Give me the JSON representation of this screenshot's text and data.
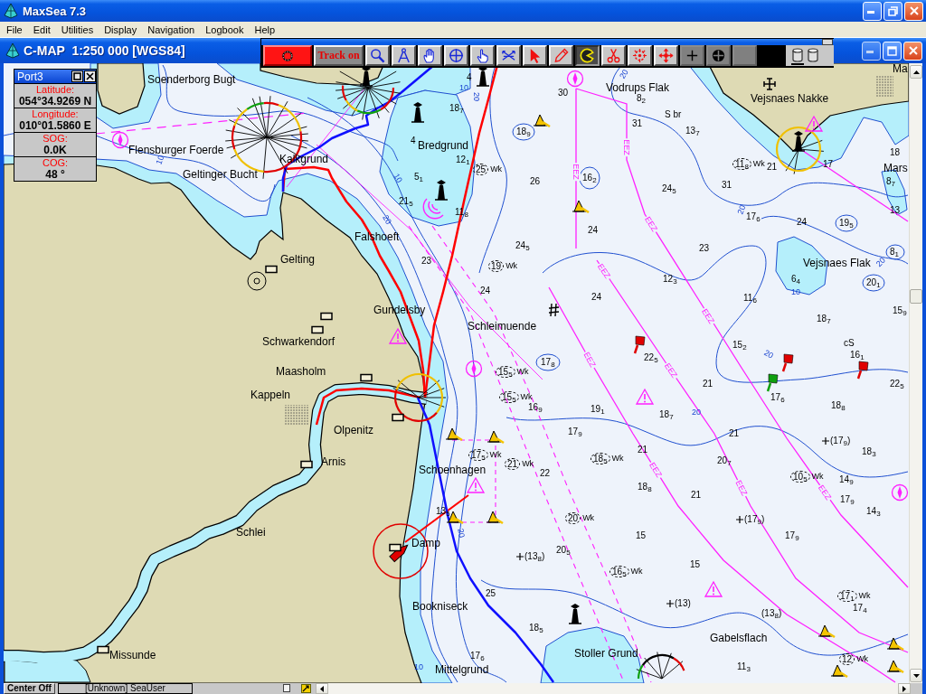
{
  "app_window": {
    "title": "MaxSea 7.3"
  },
  "menu": [
    "File",
    "Edit",
    "Utilities",
    "Display",
    "Navigation",
    "Logbook",
    "Help"
  ],
  "chart_window": {
    "title": "C-MAP  1:250 000 [WGS84]"
  },
  "toolbar": {
    "buttons": [
      {
        "kind": "record",
        "selected": false,
        "disabled": false
      },
      {
        "kind": "text",
        "label": "Track on",
        "selected": false,
        "disabled": false
      },
      {
        "kind": "magnifier",
        "selected": false,
        "disabled": false
      },
      {
        "kind": "dividers",
        "selected": false,
        "disabled": false
      },
      {
        "kind": "hand",
        "selected": false,
        "disabled": false
      },
      {
        "kind": "crosshair",
        "selected": false,
        "disabled": false
      },
      {
        "kind": "pointing-hand",
        "selected": false,
        "disabled": false
      },
      {
        "kind": "crossed-lines",
        "selected": false,
        "disabled": false
      },
      {
        "kind": "arrow",
        "selected": false,
        "disabled": false
      },
      {
        "kind": "pencil",
        "selected": false,
        "disabled": false
      },
      {
        "kind": "pie",
        "selected": true,
        "disabled": false
      },
      {
        "kind": "scissors",
        "selected": false,
        "disabled": false
      },
      {
        "kind": "target",
        "selected": false,
        "disabled": false
      },
      {
        "kind": "move",
        "selected": false,
        "disabled": false
      },
      {
        "kind": "plus",
        "selected": false,
        "disabled": true
      },
      {
        "kind": "circle-plus",
        "selected": false,
        "disabled": true
      },
      {
        "kind": "blank",
        "selected": false,
        "disabled": true
      }
    ],
    "layers": [
      {
        "selected": true
      },
      {
        "selected": false
      }
    ]
  },
  "position_window": {
    "title": "Port3",
    "fields": [
      {
        "label": "Latitude:",
        "value": "054°34.9269 N"
      },
      {
        "label": "Longitude:",
        "value": "010°01.5860 E"
      },
      {
        "label": "SOG:",
        "value": "0.0K"
      },
      {
        "label": "COG:",
        "value": "48 °"
      }
    ]
  },
  "chart": {
    "place_names": [
      "Ma",
      "Soenderborg Bugt",
      "Vodrups Flak",
      "Vejsnaes Nakke",
      "Flensburger Foerde",
      "Bredgrund",
      "Kalkgrund",
      "Geltinger Bucht",
      "Mars",
      "Falshoeft",
      "Gelting",
      "Vejsnaes Flak",
      "Gundelsby",
      "Schleimuende",
      "Schwarkendorf",
      "Maasholm",
      "Kappeln",
      "Olpenitz",
      "Arnis",
      "Schoenhagen",
      "Schlei",
      "Damp",
      "Bookniseck",
      "Gabelsflach",
      "Missunde",
      "Stoller Grund",
      "Mittelgrund"
    ],
    "soundings": [
      "4",
      "30",
      "8$_{2}$",
      "18$_{7}$",
      "31",
      "18$_{9}$",
      "13$_{7}$",
      "4",
      "18",
      "12$_{1}$",
      "21",
      "17",
      "5$_{1}$",
      "26",
      "16$_{2}$",
      "24$_{5}$",
      "31",
      "8$_{7}$",
      "21$_{5}$",
      "11$_{8}$",
      "17$_{6}$",
      "13",
      "24",
      "19$_{5}$",
      "24",
      "24$_{5}$",
      "23",
      "8$_{1}$",
      "23",
      "12$_{3}$",
      "6$_{4}$",
      "20$_{1}$",
      "24",
      "24",
      "11$_{6}$",
      "15$_{9}$",
      "18$_{7}$",
      "15$_{2}$",
      "17$_{8}$",
      "22$_{5}$",
      "16$_{1}$",
      "21",
      "22$_{5}$",
      "17$_{6}$",
      "16$_{9}$",
      "19$_{1}$",
      "18$_{7}$",
      "18$_{8}$",
      "17$_{9}$",
      "21",
      "(17$_{9}$)",
      "21",
      "18$_{3}$",
      "20$_{7}$",
      "22",
      "14$_{9}$",
      "18$_{8}$",
      "21",
      "17$_{9}$",
      "13$_{5}$",
      "14$_{3}$",
      "(17$_{9}$)",
      "15",
      "17$_{9}$",
      "(13$_{8}$)",
      "20$_{5}$",
      "15",
      "25",
      "(13)",
      "(13$_{8}$)",
      "17$_{4}$",
      "18$_{5}$",
      "17$_{6}$",
      "11$_{3}$"
    ],
    "wrecks": [
      {
        "depth": "25",
        "label": "Wk"
      },
      {
        "depth": "11$_{8}$",
        "label": "Wk"
      },
      {
        "depth": "19",
        "label": "Wk"
      },
      {
        "depth": "15$_{5}$",
        "label": "Wk"
      },
      {
        "depth": "15$_{5}$",
        "label": "Wk"
      },
      {
        "depth": "17$_{5}$",
        "label": "Wk"
      },
      {
        "depth": "21",
        "label": "Wk"
      },
      {
        "depth": "18$_{5}$",
        "label": "Wk"
      },
      {
        "depth": "10$_{5}$",
        "label": "Wk"
      },
      {
        "depth": "20",
        "label": "Wk"
      },
      {
        "depth": "16$_{5}$",
        "label": "Wk"
      },
      {
        "depth": "17$_{1}$",
        "label": "Wk"
      },
      {
        "depth": "12",
        "label": "Wk"
      }
    ],
    "contour_labels": [
      "20",
      "10",
      "20",
      "10",
      "10",
      "20",
      "20",
      "20",
      "10",
      "20",
      "20",
      "20",
      "10"
    ],
    "zone_labels": [
      "EEZ",
      "EEZ",
      "EEZ",
      "EEZ",
      "EEZ",
      "EEZ",
      "EEZ",
      "EEZ",
      "EEZ",
      "EEZ"
    ],
    "seabed_notes": [
      "S br",
      "cS"
    ]
  },
  "status_bar": {
    "center_button": "Center Off",
    "user": "[Unknown] SeaUser"
  }
}
